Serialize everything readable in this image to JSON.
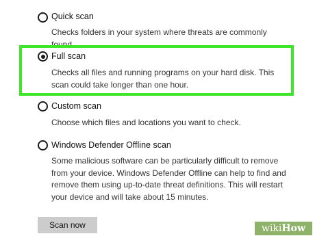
{
  "options": [
    {
      "label": "Quick scan",
      "description": "Checks folders in your system where threats are commonly found.",
      "selected": false
    },
    {
      "label": "Full scan",
      "description": "Checks all files and running programs on your hard disk. This scan could take longer than one hour.",
      "selected": true
    },
    {
      "label": "Custom scan",
      "description": "Choose which files and locations you want to check.",
      "selected": false
    },
    {
      "label": "Windows Defender Offline scan",
      "description": "Some malicious software can be particularly difficult to remove from your device. Windows Defender Offline can help to find and remove them using up-to-date threat definitions. This will restart your device and will take about 15 minutes.",
      "selected": false
    }
  ],
  "scan_button": {
    "label": "Scan now"
  },
  "watermark": {
    "prefix": "wiki",
    "suffix": "How"
  },
  "colors": {
    "highlight": "#3ee62a",
    "button": "#cccccc",
    "watermark": "#8fb26a"
  }
}
